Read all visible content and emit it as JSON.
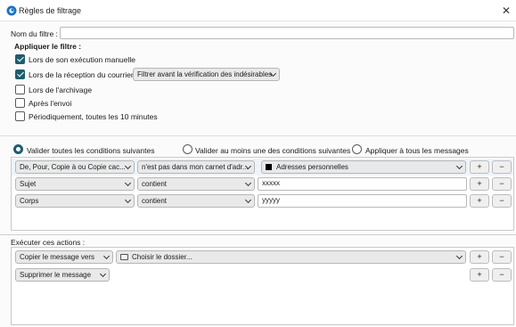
{
  "window": {
    "title": "Règles de filtrage",
    "close_glyph": "✕"
  },
  "filter_name": {
    "label": "Nom du filtre :",
    "value": ""
  },
  "apply": {
    "heading": "Appliquer le filtre :",
    "options": [
      {
        "label": "Lors de son exécution manuelle",
        "checked": true
      },
      {
        "label": "Lors de la réception du courrier :",
        "checked": true
      },
      {
        "label": "Lors de l'archivage",
        "checked": false
      },
      {
        "label": "Après l'envoi",
        "checked": false
      },
      {
        "label": "Périodiquement, toutes les 10 minutes",
        "checked": false
      }
    ],
    "reception_select": "Filtrer avant la vérification des indésirables"
  },
  "match": {
    "options": [
      {
        "label": "Valider toutes les conditions suivantes",
        "checked": true
      },
      {
        "label": "Valider au moins une des conditions suivantes",
        "checked": false
      },
      {
        "label": "Appliquer à tous les messages",
        "checked": false
      }
    ]
  },
  "conditions": [
    {
      "field": "De, Pour, Copie à ou Copie cac...",
      "operator": "n'est pas dans mon carnet d'adr...",
      "value": "Adresses personnelles",
      "value_type": "select"
    },
    {
      "field": "Sujet",
      "operator": "contient",
      "value": "xxxxx",
      "value_type": "text"
    },
    {
      "field": "Corps",
      "operator": "contient",
      "value": "yyyyy",
      "value_type": "text"
    }
  ],
  "actions": {
    "heading": "Exécuter ces actions :",
    "items": [
      {
        "action": "Copier le message vers",
        "target": "Choisir le dossier..."
      },
      {
        "action": "Supprimer le message",
        "target": ""
      }
    ]
  },
  "buttons": {
    "add": "+",
    "remove": "−"
  },
  "colors": {
    "accent": "#1f5c6e",
    "icon_blue": "#1a73c8"
  }
}
